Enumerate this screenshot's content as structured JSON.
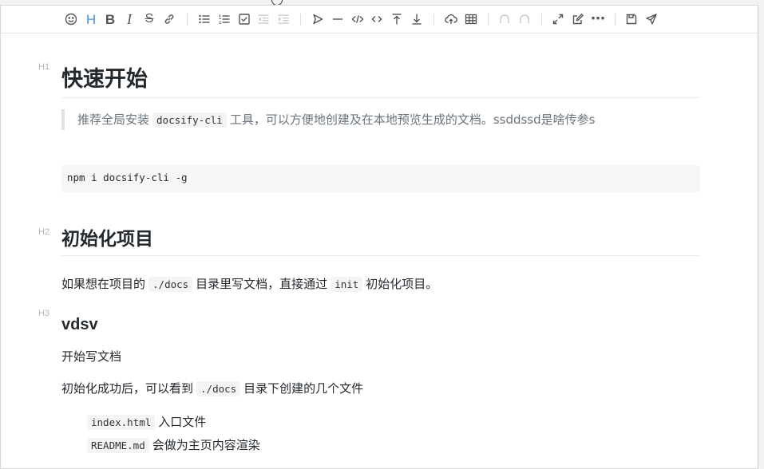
{
  "toolbar": {
    "groups": [
      [
        "emoji",
        "header",
        "bold",
        "italic",
        "strikethrough",
        "link"
      ],
      [
        "unordered-list",
        "ordered-list",
        "checklist",
        "outdent",
        "indent"
      ],
      [
        "quote",
        "horizontal-rule",
        "code",
        "inline-code",
        "insert-before",
        "insert-after"
      ],
      [
        "upload",
        "table"
      ],
      [
        "undo",
        "redo"
      ],
      [
        "fullscreen",
        "edit",
        "more"
      ],
      [
        "save",
        "publish"
      ]
    ],
    "header_glyph": "H",
    "bold_glyph": "B",
    "italic_glyph": "I",
    "strike_glyph": "S",
    "more_glyph": "⋯",
    "active_color": "#4a90e2"
  },
  "doc": {
    "h1_level": "H1",
    "h1": "快速开始",
    "quote_before": "推荐全局安装",
    "quote_code": "docsify-cli",
    "quote_after": "工具，可以方便地创建及在本地预览生成的文档。ssddssd是啥传参s",
    "code_block": "npm i docsify-cli -g",
    "h2_level": "H2",
    "h2": "初始化项目",
    "p1_before": "如果想在项目的",
    "p1_code1": "./docs",
    "p1_mid": "目录里写文档，直接通过",
    "p1_code2": "init",
    "p1_after": "初始化项目。",
    "h3_level": "H3",
    "h3": "vdsv",
    "p2": "开始写文档",
    "p3_before": "初始化成功后，可以看到",
    "p3_code": "./docs",
    "p3_after": "目录下创建的几个文件",
    "list": [
      {
        "code": "index.html",
        "text": "入口文件"
      },
      {
        "code": "README.md",
        "text": "会做为主页内容渲染"
      }
    ]
  }
}
